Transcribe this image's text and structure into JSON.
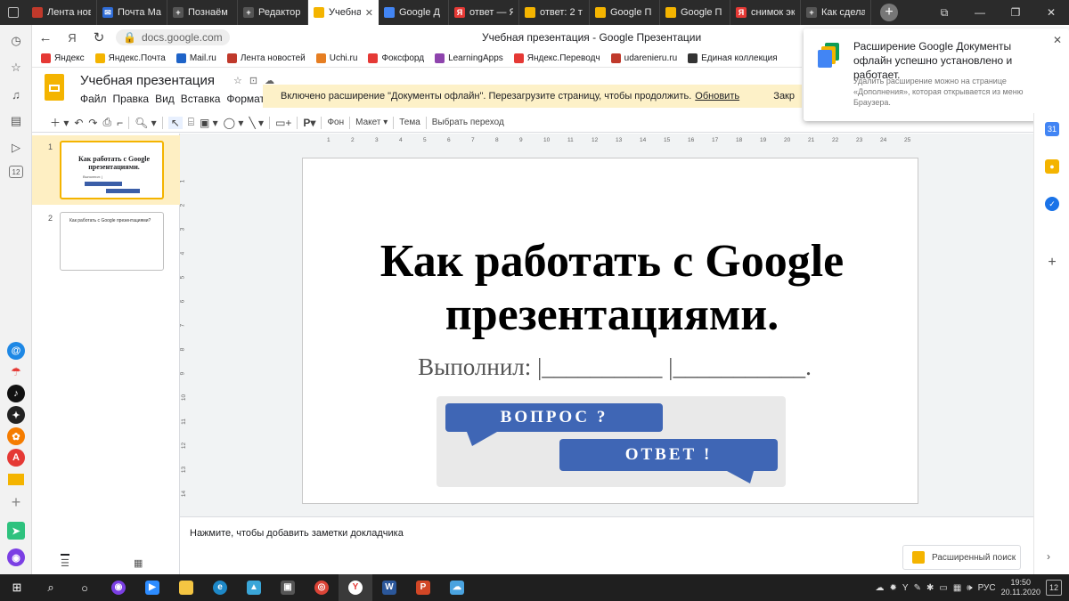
{
  "browser": {
    "tabs": [
      {
        "label": "Лента нов",
        "fav_color": "#c0392b",
        "fav_glyph": ""
      },
      {
        "label": "Почта Ма",
        "fav_color": "#2f6cd6",
        "fav_glyph": "✉"
      },
      {
        "label": "Познаём",
        "fav_color": "#555555",
        "fav_glyph": "+"
      },
      {
        "label": "Редактор",
        "fav_color": "#555555",
        "fav_glyph": "+"
      },
      {
        "label": "Учебна",
        "fav_color": "#f4b400",
        "fav_glyph": "",
        "active": true,
        "close": "✕"
      },
      {
        "label": "Google Д",
        "fav_color": "#4285f4",
        "fav_glyph": ""
      },
      {
        "label": "ответ — Я",
        "fav_color": "#e53935",
        "fav_glyph": "Я"
      },
      {
        "label": "ответ: 2 т",
        "fav_color": "#f4b400",
        "fav_glyph": ""
      },
      {
        "label": "Google П",
        "fav_color": "#f4b400",
        "fav_glyph": ""
      },
      {
        "label": "Google П",
        "fav_color": "#f4b400",
        "fav_glyph": ""
      },
      {
        "label": "снимок эк",
        "fav_color": "#e53935",
        "fav_glyph": "Я"
      },
      {
        "label": "Как сдела",
        "fav_color": "#555555",
        "fav_glyph": "+"
      }
    ],
    "url": "docs.google.com",
    "page_title": "Учебная презентация - Google Презентации",
    "yandex_glyph": "Я"
  },
  "bookmarks": [
    {
      "label": "Яндекс",
      "color": "#e53935"
    },
    {
      "label": "Яндекс.Почта",
      "color": "#f4b400"
    },
    {
      "label": "Mail.ru",
      "color": "#1e63c8"
    },
    {
      "label": "Лента новостей",
      "color": "#c0392b"
    },
    {
      "label": "Uchi.ru",
      "color": "#e67e22"
    },
    {
      "label": "Фоксфорд",
      "color": "#e53935"
    },
    {
      "label": "LearningApps",
      "color": "#8e44ad"
    },
    {
      "label": "Яндекс.Переводч",
      "color": "#e53935"
    },
    {
      "label": "udarenieru.ru",
      "color": "#c0392b"
    },
    {
      "label": "Единая коллекция",
      "color": "#333333"
    }
  ],
  "docs": {
    "title": "Учебная презентация",
    "menu": [
      "Файл",
      "Правка",
      "Вид",
      "Вставка",
      "Формат"
    ]
  },
  "banner": {
    "text": "Включено расширение \"Документы офлайн\". Перезагрузите страницу, чтобы продолжить.",
    "link": "Обновить",
    "close": "Закр"
  },
  "notification": {
    "title": "Расширение Google Документы офлайн успешно установлено и работает.",
    "subtitle": "Удалить расширение можно на странице «Дополнения», которая открывается из меню Браузера."
  },
  "toolbar": {
    "bg": "Фон",
    "layout": "Макет ▾",
    "theme": "Тема",
    "transition": "Выбрать переход"
  },
  "filmstrip": {
    "slides": [
      {
        "num": "1",
        "title": "Как работать с Google презентациями.",
        "subtitle": "Выполнил: |",
        "q": "ВОПРОС ?",
        "a": "ОТВЕТ !"
      },
      {
        "num": "2",
        "title": "Как работать с Google презентациями?"
      }
    ]
  },
  "ruler": {
    "h": [
      "1",
      "2",
      "3",
      "4",
      "5",
      "6",
      "7",
      "8",
      "9",
      "10",
      "11",
      "12",
      "13",
      "14",
      "15",
      "16",
      "17",
      "18",
      "19",
      "20",
      "21",
      "22",
      "23",
      "24",
      "25"
    ],
    "v": [
      "1",
      "2",
      "3",
      "4",
      "5",
      "6",
      "7",
      "8",
      "9",
      "10",
      "11",
      "12",
      "13",
      "14"
    ]
  },
  "slide": {
    "title": "Как работать с Google презентациями.",
    "subtitle": "Выполнил: |__________ |___________.",
    "question": "ВОПРОС  ?",
    "answer": "ОТВЕТ  !"
  },
  "notes": {
    "placeholder": "Нажмите, чтобы добавить заметки докладчика"
  },
  "advanced_search": "Расширенный поиск",
  "taskbar": {
    "lang": "РУС",
    "time": "19:50",
    "date": "20.11.2020",
    "badge": "12"
  },
  "sidebar_badge": "12",
  "colors": {
    "accent": "#f4b400",
    "slide_bubble": "#3f66b5",
    "banner_bg": "#fdf1c8"
  }
}
